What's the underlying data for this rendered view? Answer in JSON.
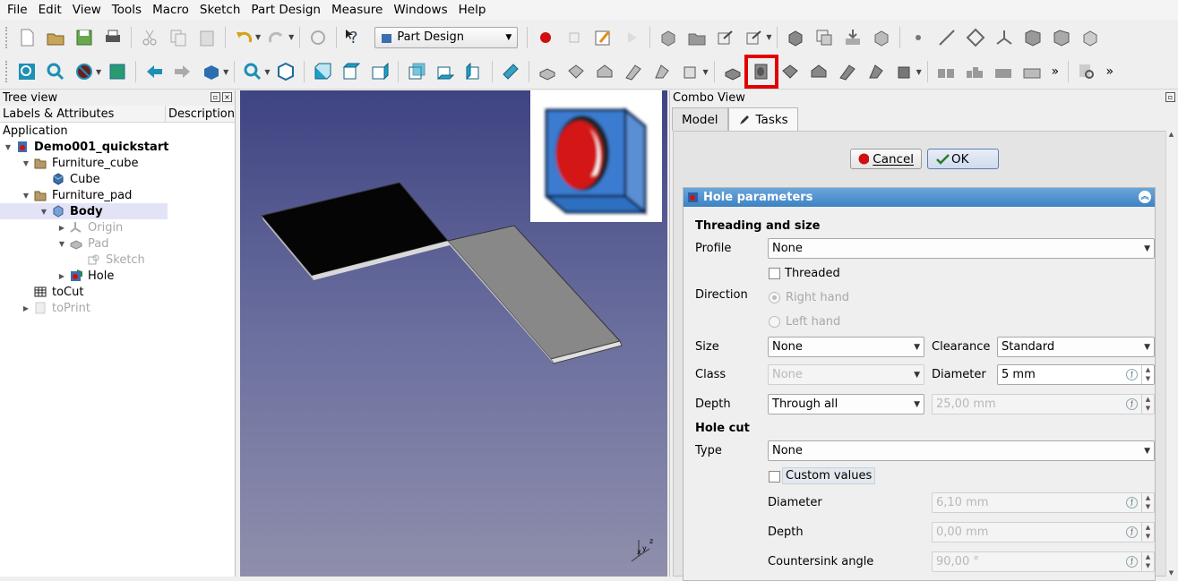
{
  "menu": [
    "File",
    "Edit",
    "View",
    "Tools",
    "Macro",
    "Sketch",
    "Part Design",
    "Measure",
    "Windows",
    "Help"
  ],
  "workbench": "Part Design",
  "tree": {
    "title": "Tree view",
    "col1": "Labels & Attributes",
    "col2": "Description",
    "root": "Application",
    "items": [
      {
        "label": "Demo001_quickstart",
        "bold": true
      },
      {
        "label": "Furniture_cube"
      },
      {
        "label": "Cube"
      },
      {
        "label": "Furniture_pad"
      },
      {
        "label": "Body",
        "bold": true
      },
      {
        "label": "Origin"
      },
      {
        "label": "Pad"
      },
      {
        "label": "Sketch"
      },
      {
        "label": "Hole"
      },
      {
        "label": "toCut"
      },
      {
        "label": "toPrint"
      }
    ]
  },
  "combo": {
    "title": "Combo View",
    "tab_model": "Model",
    "tab_tasks": "Tasks",
    "cancel": "Cancel",
    "ok": "OK",
    "group_title": "Hole parameters",
    "threading_section": "Threading and size",
    "profile_label": "Profile",
    "profile_value": "None",
    "threaded_label": "Threaded",
    "direction_label": "Direction",
    "right_hand": "Right hand",
    "left_hand": "Left hand",
    "size_label": "Size",
    "size_value": "None",
    "clearance_label": "Clearance",
    "clearance_value": "Standard",
    "class_label": "Class",
    "class_value": "None",
    "diameter_label": "Diameter",
    "diameter_value": "5 mm",
    "depth_label": "Depth",
    "depth_value": "Through all",
    "depth_amount": "25,00 mm",
    "holecut_section": "Hole cut",
    "type_label": "Type",
    "type_value": "None",
    "custom_values": "Custom values",
    "cut_diameter_label": "Diameter",
    "cut_diameter_value": "6,10 mm",
    "cut_depth_label": "Depth",
    "cut_depth_value": "0,00 mm",
    "countersink_label": "Countersink angle",
    "countersink_value": "90,00 °"
  },
  "colors": {
    "accent": "#3c82c4",
    "highlight": "#e00000"
  }
}
